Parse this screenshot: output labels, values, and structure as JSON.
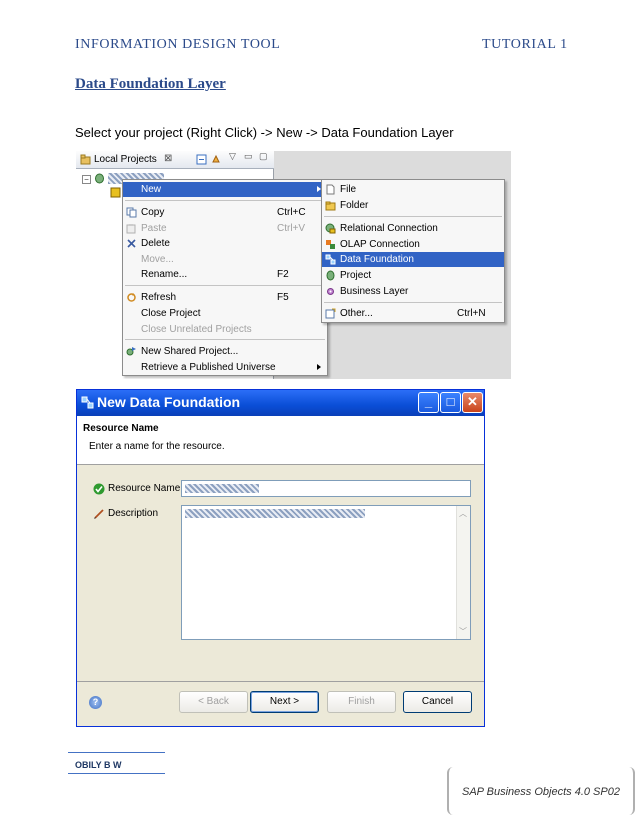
{
  "header": {
    "left": "INFORMATION DESIGN TOOL",
    "right": "TUTORIAL 1"
  },
  "section_title": "Data Foundation Layer",
  "instruction": "Select your project (Right Click) -> New -> Data Foundation Layer",
  "explorer": {
    "tab_label": "Local Projects"
  },
  "context_menu": {
    "items": [
      {
        "label": "New",
        "shortcut": "",
        "icon": "none",
        "state": "selected",
        "submenu": true
      },
      {
        "label": "Copy",
        "shortcut": "Ctrl+C",
        "icon": "copy-icon",
        "state": "enabled"
      },
      {
        "label": "Paste",
        "shortcut": "Ctrl+V",
        "icon": "paste-icon",
        "state": "disabled"
      },
      {
        "label": "Delete",
        "shortcut": "",
        "icon": "delete-icon",
        "state": "enabled"
      },
      {
        "label": "Move...",
        "shortcut": "",
        "icon": "none",
        "state": "disabled"
      },
      {
        "label": "Rename...",
        "shortcut": "F2",
        "icon": "none",
        "state": "enabled"
      },
      {
        "label": "Refresh",
        "shortcut": "F5",
        "icon": "refresh-icon",
        "state": "enabled"
      },
      {
        "label": "Close Project",
        "shortcut": "",
        "icon": "none",
        "state": "enabled"
      },
      {
        "label": "Close Unrelated Projects",
        "shortcut": "",
        "icon": "none",
        "state": "disabled"
      },
      {
        "label": "New Shared Project...",
        "shortcut": "",
        "icon": "shared-project-icon",
        "state": "enabled"
      },
      {
        "label": "Retrieve a Published Universe",
        "shortcut": "",
        "icon": "none",
        "state": "enabled",
        "submenu": true
      }
    ]
  },
  "submenu": {
    "items": [
      {
        "label": "File",
        "shortcut": "",
        "icon": "file-icon",
        "state": "enabled"
      },
      {
        "label": "Folder",
        "shortcut": "",
        "icon": "folder-icon",
        "state": "enabled"
      },
      {
        "label": "Relational Connection",
        "shortcut": "",
        "icon": "relational-connection-icon",
        "state": "enabled"
      },
      {
        "label": "OLAP Connection",
        "shortcut": "",
        "icon": "olap-connection-icon",
        "state": "enabled"
      },
      {
        "label": "Data Foundation",
        "shortcut": "",
        "icon": "data-foundation-icon",
        "state": "selected"
      },
      {
        "label": "Project",
        "shortcut": "",
        "icon": "project-icon",
        "state": "enabled"
      },
      {
        "label": "Business Layer",
        "shortcut": "",
        "icon": "business-layer-icon",
        "state": "enabled"
      },
      {
        "label": "Other...",
        "shortcut": "Ctrl+N",
        "icon": "other-icon",
        "state": "enabled"
      }
    ]
  },
  "wizard": {
    "title": "New Data Foundation",
    "banner_heading": "Resource Name",
    "banner_text": "Enter a name for the resource.",
    "resource_name_label": "Resource Name",
    "description_label": "Description",
    "buttons": {
      "back": "< Back",
      "next": "Next >",
      "finish": "Finish",
      "cancel": "Cancel"
    },
    "help": "?"
  },
  "author": "OBILY B W",
  "footer": "SAP Business Objects 4.0 SP02"
}
